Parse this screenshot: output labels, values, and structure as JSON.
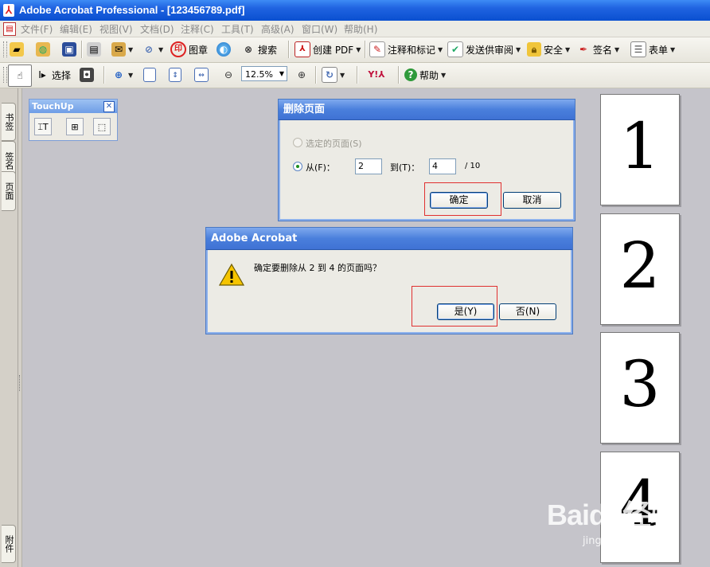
{
  "window": {
    "title": "Adobe Acrobat Professional - [123456789.pdf]"
  },
  "menu": [
    "文件(F)",
    "编辑(E)",
    "视图(V)",
    "文档(D)",
    "注释(C)",
    "工具(T)",
    "高级(A)",
    "窗口(W)",
    "帮助(H)"
  ],
  "toolbar1": {
    "stamp_label": "图章",
    "search_label": "搜索",
    "create_pdf_label": "创建 PDF",
    "comment_label": "注释和标记",
    "review_label": "发送供审阅",
    "security_label": "安全",
    "sign_label": "签名",
    "forms_label": "表单"
  },
  "toolbar2": {
    "select_label": "选择",
    "zoom_value": "12.5%",
    "help_label": "帮助"
  },
  "left_tabs": [
    "书签",
    "签名",
    "页面",
    "附件"
  ],
  "touchup": {
    "title": "TouchUp"
  },
  "delete_dialog": {
    "title": "删除页面",
    "option_selected": "选定的页面(S)",
    "option_from": "从(F)：",
    "from_value": "2",
    "to_label": "到(T)：",
    "to_value": "4",
    "total": "/ 10",
    "ok_label": "确定",
    "cancel_label": "取消"
  },
  "confirm_dialog": {
    "title": "Adobe Acrobat",
    "message": "确定要删除从 2 到 4 的页面吗？",
    "yes_label": "是(Y)",
    "no_label": "否(N)"
  },
  "thumbnails": [
    "1",
    "2",
    "3",
    "4"
  ],
  "watermark": {
    "logo": "Baidu经验",
    "url": "jingyan.baidu.com"
  },
  "colors": {
    "accent": "#0a4fd0",
    "highlight": "#e03030",
    "warning": "#f5c400"
  }
}
